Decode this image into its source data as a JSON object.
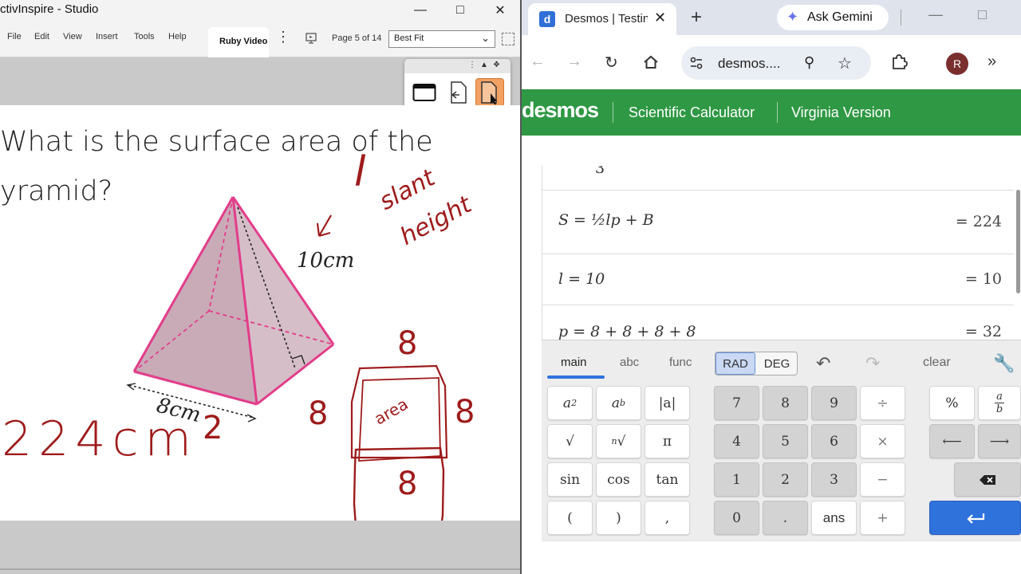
{
  "inspire": {
    "title": "ctivInspire - Studio",
    "menu": [
      "File",
      "Edit",
      "View",
      "Insert",
      "Tools",
      "Help"
    ],
    "tab_label": "Ruby Video",
    "page_count": "Page 5 of 14",
    "fit_value": "Best Fit",
    "question_line1": "What is the surface area of the",
    "question_line2": "yramid?",
    "pyramid_edge_label": "10cm",
    "pyramid_base_label": "8cm",
    "handwriting": {
      "l": "l",
      "slant": "slant",
      "height": "height",
      "answer": "224cm",
      "exponent": "2",
      "side_top": "8",
      "side_left": "8",
      "side_right": "8",
      "side_bottom": "8",
      "inner": "area"
    }
  },
  "chrome": {
    "tab_title": "Desmos | Testing",
    "gemini_label": "Ask Gemini",
    "url": "desmos....",
    "avatar_letter": "R",
    "favicon_letter": "d"
  },
  "desmos": {
    "logo": "desmos",
    "link1": "Scientific Calculator",
    "link2": "Virginia Version",
    "partial_row": "3",
    "expressions": [
      {
        "lhs": "S = ½lp + B",
        "rhs": "= 224"
      },
      {
        "lhs": "l = 10",
        "rhs": "= 10"
      },
      {
        "lhs": "p = 8 + 8 + 8 + 8",
        "rhs": "= 32"
      }
    ],
    "keypad_tabs": [
      "main",
      "abc",
      "func"
    ],
    "rad": "RAD",
    "deg": "DEG",
    "clear": "clear",
    "keys": {
      "abs": "|a|",
      "pi": "π",
      "sin": "sin",
      "cos": "cos",
      "tan": "tan",
      "lparen": "(",
      "rparen": ")",
      "comma": ",",
      "n7": "7",
      "n8": "8",
      "n9": "9",
      "n4": "4",
      "n5": "5",
      "n6": "6",
      "n1": "1",
      "n2": "2",
      "n3": "3",
      "n0": "0",
      "dot": ".",
      "ans": "ans",
      "div": "÷",
      "mul": "×",
      "minus": "−",
      "plus": "+",
      "percent": "%",
      "left": "⟵",
      "right": "⟶",
      "sqrt": "√"
    }
  },
  "colors": {
    "desmos_green": "#2f9844",
    "pink": "#e23d8a",
    "ink_red": "#9e1b1b",
    "highlight_orange": "#f2a162",
    "blue_key": "#2f72dc"
  }
}
